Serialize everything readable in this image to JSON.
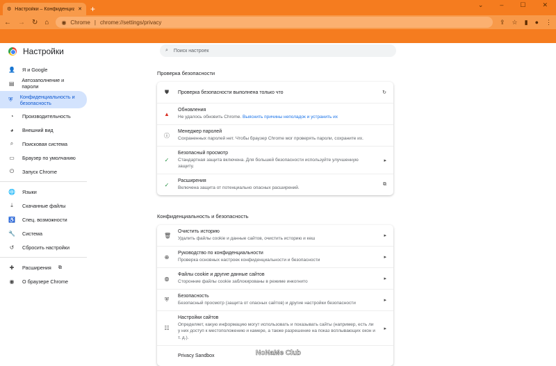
{
  "browser": {
    "tab_title": "Настройки – Конфиденциальность",
    "new_tab": "+",
    "close": "✕",
    "omni_site": "Chrome",
    "url": "chrome://settings/privacy"
  },
  "header": {
    "title": "Настройки",
    "search_placeholder": "Поиск настроек"
  },
  "sidebar": {
    "items": [
      {
        "label": "Я и Google",
        "icon": "person-icon",
        "glyph": "👤"
      },
      {
        "label": "Автозаполнение и пароли",
        "icon": "clipboard-icon",
        "glyph": "▤"
      },
      {
        "label": "Конфиденциальность и безопасность",
        "icon": "shield-icon",
        "glyph": "⛨"
      },
      {
        "label": "Производительность",
        "icon": "gauge-icon",
        "glyph": "◔"
      },
      {
        "label": "Внешний вид",
        "icon": "palette-icon",
        "glyph": "◕"
      },
      {
        "label": "Поисковая система",
        "icon": "search-icon",
        "glyph": "⌕"
      },
      {
        "label": "Браузер по умолчанию",
        "icon": "browser-icon",
        "glyph": "▭"
      },
      {
        "label": "Запуск Chrome",
        "icon": "power-icon",
        "glyph": "⏻"
      },
      {
        "label": "Языки",
        "icon": "globe-icon",
        "glyph": "🌐"
      },
      {
        "label": "Скачанные файлы",
        "icon": "download-icon",
        "glyph": "⤓"
      },
      {
        "label": "Спец. возможности",
        "icon": "accessibility-icon",
        "glyph": "♿"
      },
      {
        "label": "Система",
        "icon": "wrench-icon",
        "glyph": "🔧"
      },
      {
        "label": "Сбросить настройки",
        "icon": "reset-icon",
        "glyph": "↺"
      },
      {
        "label": "Расширения",
        "icon": "puzzle-icon",
        "glyph": "✚"
      },
      {
        "label": "О браузере Chrome",
        "icon": "chrome-icon",
        "glyph": "◉"
      }
    ]
  },
  "safety": {
    "heading": "Проверка безопасности",
    "rows": [
      {
        "label": "Проверка безопасности выполнена только что",
        "sub": "",
        "action": "↻",
        "icon": "shield-check-icon",
        "glyph": "⛊"
      },
      {
        "label": "Обновления",
        "sub": "Не удалось обновить Chrome.",
        "link": "Выяснить причины неполадок и устранить их",
        "action": "",
        "icon": "warning-icon",
        "glyph": "▲"
      },
      {
        "label": "Менеджер паролей",
        "sub": "Сохраненных паролей нет. Чтобы браузер Chrome мог проверять пароли, сохраните их.",
        "action": "",
        "icon": "info-icon",
        "glyph": "ⓘ"
      },
      {
        "label": "Безопасный просмотр",
        "sub": "Стандартная защита включена. Для большей безопасности используйте улучшенную защиту.",
        "action": "▸",
        "icon": "check-icon",
        "glyph": "✓"
      },
      {
        "label": "Расширения",
        "sub": "Включена защита от потенциально опасных расширений.",
        "action": "⧉",
        "icon": "check-icon",
        "glyph": "✓"
      }
    ]
  },
  "privacy": {
    "heading": "Конфиденциальность и безопасность",
    "rows": [
      {
        "label": "Очистить историю",
        "sub": "Удалить файлы cookie и данные сайтов, очистить историю и кеш",
        "icon": "trash-icon",
        "glyph": "🗑"
      },
      {
        "label": "Руководство по конфиденциальности",
        "sub": "Проверка основных настроек конфиденциальности и безопасности",
        "icon": "guide-icon",
        "glyph": "⊕"
      },
      {
        "label": "Файлы cookie и другие данные сайтов",
        "sub": "Сторонние файлы cookie заблокированы в режиме инкогнито",
        "icon": "cookie-icon",
        "glyph": "◍"
      },
      {
        "label": "Безопасность",
        "sub": "Безопасный просмотр (защита от опасных сайтов) и другие настройки безопасности",
        "icon": "security-shield-icon",
        "glyph": "⛨"
      },
      {
        "label": "Настройки сайтов",
        "sub": "Определяет, какую информацию могут использовать и показывать сайты (например, есть ли у них доступ к местоположению и камере, а также разрешение на показ всплывающих окон и т. д.).",
        "icon": "sliders-icon",
        "glyph": "☷"
      },
      {
        "label": "Privacy Sandbox",
        "sub": "",
        "icon": "sandbox-icon",
        "glyph": ""
      }
    ]
  },
  "watermark": "NoNaMe Club"
}
